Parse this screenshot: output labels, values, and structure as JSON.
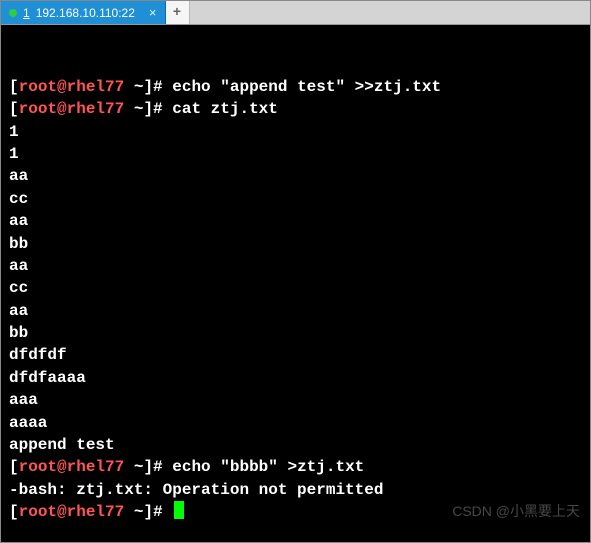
{
  "tab": {
    "number": "1",
    "title": "192.168.10.110:22",
    "close_glyph": "×"
  },
  "newtab": {
    "glyph": "+"
  },
  "prompt": {
    "open": "[",
    "userhost": "root@rhel77",
    "path_close": " ~]# "
  },
  "lines": [
    {
      "type": "cmd",
      "text": "echo \"append test\" >>ztj.txt"
    },
    {
      "type": "cmd",
      "text": "cat ztj.txt"
    },
    {
      "type": "out",
      "text": "1"
    },
    {
      "type": "out",
      "text": "1"
    },
    {
      "type": "out",
      "text": "aa"
    },
    {
      "type": "out",
      "text": "cc"
    },
    {
      "type": "out",
      "text": "aa"
    },
    {
      "type": "out",
      "text": "bb"
    },
    {
      "type": "out",
      "text": "aa"
    },
    {
      "type": "out",
      "text": "cc"
    },
    {
      "type": "out",
      "text": "aa"
    },
    {
      "type": "out",
      "text": "bb"
    },
    {
      "type": "out",
      "text": "dfdfdf"
    },
    {
      "type": "out",
      "text": "dfdfaaaa"
    },
    {
      "type": "out",
      "text": "aaa"
    },
    {
      "type": "out",
      "text": "aaaa"
    },
    {
      "type": "out",
      "text": "append test"
    },
    {
      "type": "cmd",
      "text": "echo \"bbbb\" >ztj.txt"
    },
    {
      "type": "out",
      "text": "-bash: ztj.txt: Operation not permitted"
    },
    {
      "type": "cmd",
      "text": "",
      "cursor": true
    }
  ],
  "watermark": "CSDN @小黑要上天"
}
